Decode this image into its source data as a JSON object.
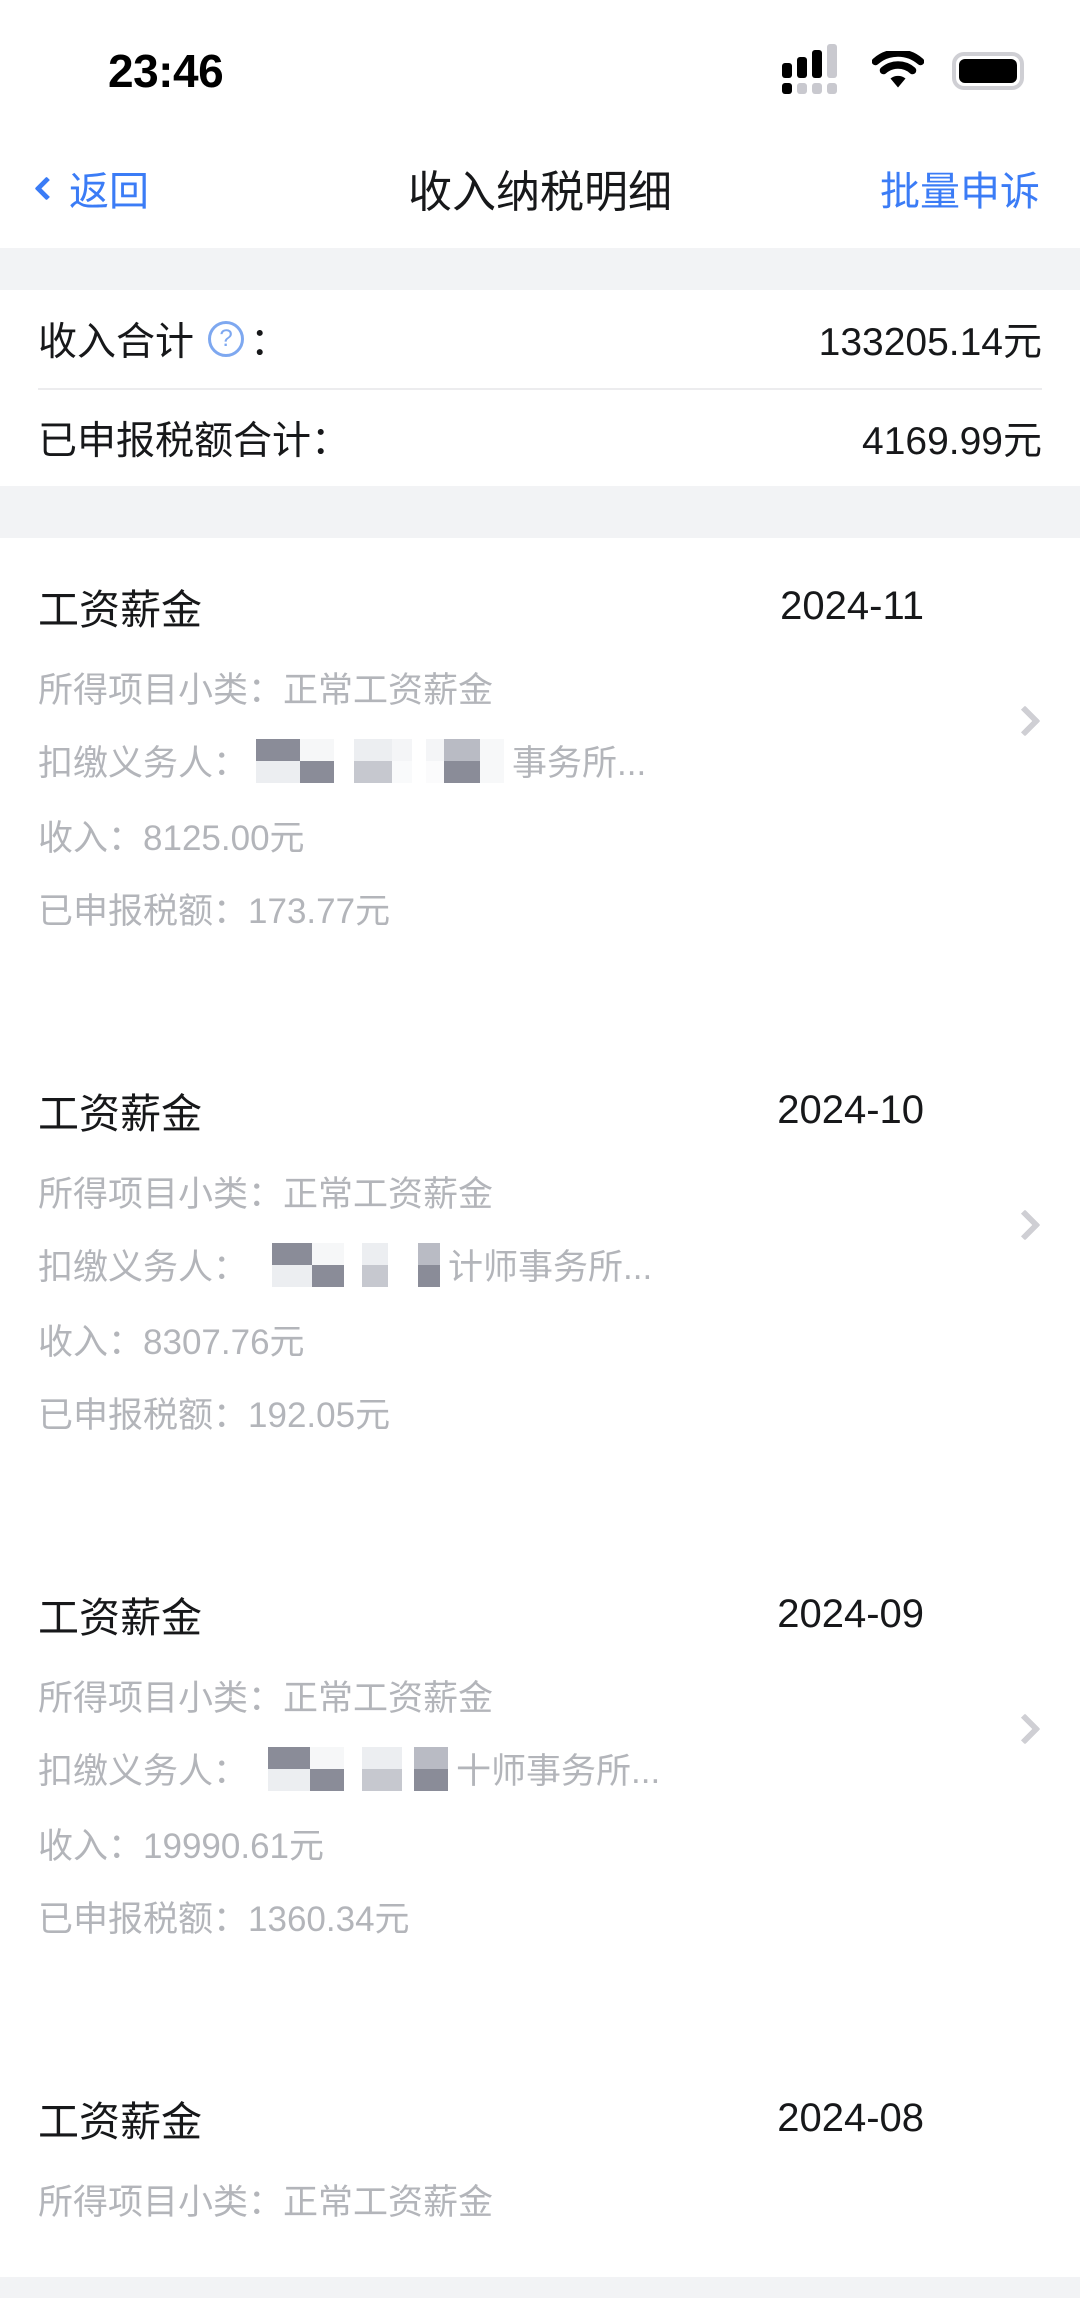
{
  "status_bar": {
    "time": "23:46",
    "signal_icon": "cellular-signal-icon",
    "wifi_icon": "wifi-icon",
    "battery_icon": "battery-full-icon"
  },
  "nav": {
    "back_label": "返回",
    "back_icon": "chevron-left-icon",
    "title": "收入纳税明细",
    "action_label": "批量申诉"
  },
  "summary": {
    "rows": [
      {
        "label": "收入合计",
        "has_help": true,
        "help_icon": "question-mark-circle-icon",
        "colon": "：",
        "value": "133205.14元"
      },
      {
        "label": "已申报税额合计",
        "has_help": false,
        "colon": "：",
        "value": "4169.99元"
      }
    ]
  },
  "list": {
    "labels": {
      "subtype": "所得项目小类：",
      "payer": "扣缴义务人：",
      "income": "收入：",
      "tax": "已申报税额："
    },
    "chevron_icon": "chevron-right-icon",
    "items": [
      {
        "title": "工资薪金",
        "date": "2024-11",
        "subtype_value": "正常工资薪金",
        "payer_redacted": true,
        "payer_suffix": "事务所...",
        "income": "8125.00元",
        "tax": "173.77元",
        "truncated": false
      },
      {
        "title": "工资薪金",
        "date": "2024-10",
        "subtype_value": "正常工资薪金",
        "payer_redacted": true,
        "payer_suffix": "计师事务所...",
        "income": "8307.76元",
        "tax": "192.05元",
        "truncated": false
      },
      {
        "title": "工资薪金",
        "date": "2024-09",
        "subtype_value": "正常工资薪金",
        "payer_redacted": true,
        "payer_suffix": "十师事务所...",
        "income": "19990.61元",
        "tax": "1360.34元",
        "truncated": false
      },
      {
        "title": "工资薪金",
        "date": "2024-08",
        "subtype_value": "正常工资薪金",
        "payer_redacted": true,
        "payer_suffix": "",
        "income": "",
        "tax": "",
        "truncated": true
      }
    ]
  },
  "colors": {
    "accent_blue": "#3b7cf6",
    "page_bg": "#f2f3f5",
    "card_bg": "#ffffff",
    "primary_text": "#17181a",
    "secondary_text": "#b3b5ba",
    "divider": "#ececee"
  }
}
